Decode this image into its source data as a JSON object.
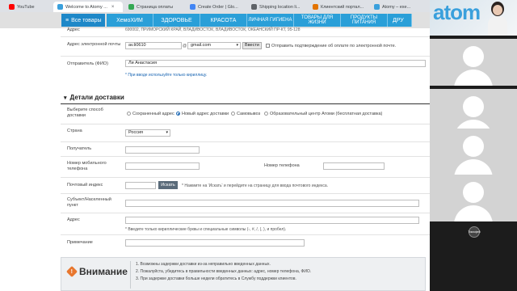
{
  "browser": {
    "tabs": [
      {
        "title": "YouTube",
        "color": "#ff0000",
        "active": false
      },
      {
        "title": "Welcome to Atomy ...",
        "color": "#3aa0dc",
        "active": true
      },
      {
        "title": "Страница оплаты",
        "color": "#34a853",
        "active": false
      },
      {
        "title": "Create Order | Glo...",
        "color": "#4285f4",
        "active": false
      },
      {
        "title": "Shipping location li...",
        "color": "#5f6368",
        "active": false
      },
      {
        "title": "Клиентский портал...",
        "color": "#e37400",
        "active": false
      },
      {
        "title": "Atomy – exe...",
        "color": "#3aa0dc",
        "active": false
      }
    ],
    "close_glyph": "×"
  },
  "nav": {
    "all_goods": "Все товары",
    "menu_icon": "≡",
    "items": [
      "ХемоХИМ",
      "ЗДОРОВЬЕ",
      "КРАСОТА",
      "ЛИЧНАЯ ГИГИЕНА",
      "ТОВАРЫ ДЛЯ ЖИЗНИ",
      "ПРОДУКТЫ ПИТАНИЯ",
      "ДРУ"
    ]
  },
  "sender": {
    "address_label": "Адрес",
    "address_value": "690002, ПРИМОРСКИЙ КРАЙ, ВЛАДИВОСТОК, ВЛАДИВОСТОК, ОКЕАНСКИЙ ПР-КТ, 95-128",
    "email_label": "Адрес электронной почты",
    "email_user": "av.li0610",
    "email_at": "@",
    "email_domain": "gmail.com",
    "enter_button": "Ввести",
    "email_confirm_checkbox": "Отправить подтверждение об оплате по электронной почте.",
    "name_label": "Отправитель (ФИО)",
    "name_value": "Ли Анастасия",
    "cyrillic_note": "* При вводе используйте только кириллицу."
  },
  "delivery": {
    "section_title": "Детали доставки",
    "toggle_icon": "▾",
    "method_label": "Выберите способ доставки",
    "methods": [
      "Сохраненный адрес",
      "Новый адрес доставки",
      "Самовывоз",
      "Образовательный центр Атоми (бесплатная доставка)"
    ],
    "selected_method": 1,
    "country_label": "Страна",
    "country_value": "Россия",
    "recipient_label": "Получатель",
    "mobile_label": "Номер мобильного телефона",
    "phone_label": "Номер телефона",
    "postcode_label": "Почтовый индекс",
    "search_button": "Искать",
    "postcode_hint": "* Нажмите на 'Искать' и перейдите на страницу для ввода почтового индекса.",
    "locality_label": "Субъект/Населенный пункт",
    "address_label": "Адрес",
    "address_hint": "* Введите только кириллические буквы и специальные символы (-, #, /, (, ), и пробел).",
    "note_label": "Примечание"
  },
  "warning": {
    "title": "Внимание",
    "icon": "!",
    "items": [
      "1. Возможны задержки доставки из-за неправильно введенных данных.",
      "2. Пожалуйста, убедитесь в правильности введенных данных: адрес, номер телефона, ФИО.",
      "3. При задержке доставки больше недели обратитесь в Службу поддержки клиентов."
    ]
  },
  "call": {
    "logo_text": "atom",
    "user_badge": "Тимофей"
  }
}
